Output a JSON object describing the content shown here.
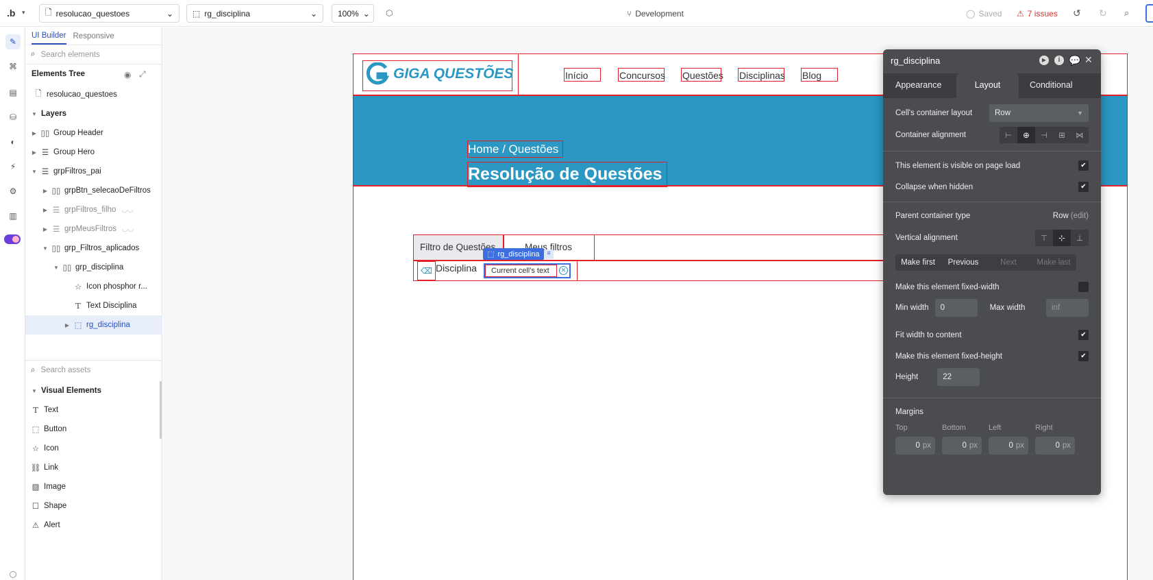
{
  "topbar": {
    "logo": ".b",
    "page_select": "resolucao_questoes",
    "element_select": "rg_disciplina",
    "zoom": "100%",
    "branch": "Development",
    "saved": "Saved",
    "issues": "7 issues"
  },
  "panel": {
    "tab_builder": "UI Builder",
    "tab_responsive": "Responsive",
    "search_elements": "Search elements",
    "tree_title": "Elements Tree",
    "tree": [
      {
        "label": "resolucao_questoes",
        "icon": "page-icon"
      },
      {
        "label": "Layers",
        "icon": ""
      },
      {
        "label": "Group Header",
        "icon": "column-group-icon"
      },
      {
        "label": "Group Hero",
        "icon": "row-group-icon"
      },
      {
        "label": "grpFiltros_pai",
        "icon": "row-group-icon"
      },
      {
        "label": "grpBtn_selecaoDeFiltros",
        "icon": "column-group-icon"
      },
      {
        "label": "grpFiltros_filho",
        "icon": "row-group-icon"
      },
      {
        "label": "grpMeusFiltros",
        "icon": "row-group-icon"
      },
      {
        "label": "grp_Filtros_aplicados",
        "icon": "column-group-icon"
      },
      {
        "label": "grp_disciplina",
        "icon": "column-group-icon"
      },
      {
        "label": "Icon phosphor r...",
        "icon": "star-icon"
      },
      {
        "label": "Text Disciplina",
        "icon": "text-icon"
      },
      {
        "label": "rg_disciplina",
        "icon": "repeating-group-icon"
      }
    ],
    "search_assets": "Search assets",
    "assets_title": "Visual Elements",
    "assets": [
      "Text",
      "Button",
      "Icon",
      "Link",
      "Image",
      "Shape",
      "Alert"
    ]
  },
  "canvas": {
    "logo_text": "GIGA QUESTÕES",
    "nav": [
      "Início",
      "Concursos",
      "Questões",
      "Disciplinas",
      "Blog"
    ],
    "breadcrumb": "Home / Questões",
    "hero_title": "Resolução de Questões",
    "tab_filter": "Filtro de Questões",
    "tab_my_filters": "Meus filtros",
    "selection_tag": "rg_disciplina",
    "chip_label": "Disciplina",
    "cell_text": "Current cell's text"
  },
  "props": {
    "title": "rg_disciplina",
    "tabs": [
      "Appearance",
      "Layout",
      "Conditional"
    ],
    "cells_layout_label": "Cell's container layout",
    "cells_layout_value": "Row",
    "container_alignment": "Container alignment",
    "visible_on_load": "This element is visible on page load",
    "collapse_hidden": "Collapse when hidden",
    "parent_type_label": "Parent container type",
    "parent_type_value": "Row",
    "parent_type_edit": "(edit)",
    "vertical_alignment": "Vertical alignment",
    "order_buttons": [
      "Make first",
      "Previous",
      "Next",
      "Make last"
    ],
    "fixed_width": "Make this element fixed-width",
    "min_width_label": "Min width",
    "min_width_value": "0",
    "max_width_label": "Max width",
    "max_width_placeholder": "inf",
    "fit_width": "Fit width to content",
    "fixed_height": "Make this element fixed-height",
    "height_label": "Height",
    "height_value": "22",
    "margins_label": "Margins",
    "margin_top": "Top",
    "margin_bottom": "Bottom",
    "margin_left": "Left",
    "margin_right": "Right",
    "margin_value": "0",
    "unit": "px"
  },
  "colors": {
    "accent": "#2b97c3",
    "outline": "#e2202a",
    "panel_bg": "#4a4c50",
    "selection": "#3d6fe0",
    "issues": "#d9352a"
  }
}
